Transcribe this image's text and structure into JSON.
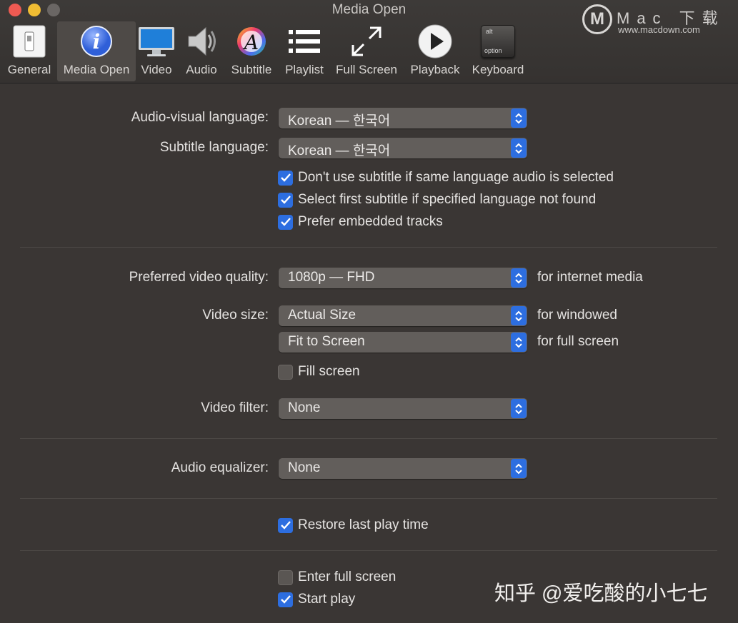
{
  "window": {
    "title": "Media Open"
  },
  "colors": {
    "accent": "#2d6ee0",
    "background": "#3a3634",
    "close": "#ee5a52",
    "minimize": "#f1bd33",
    "zoom": "#6a6664"
  },
  "toolbar": {
    "tabs": [
      {
        "label": "General",
        "icon": "switch-icon"
      },
      {
        "label": "Media Open",
        "icon": "info-icon"
      },
      {
        "label": "Video",
        "icon": "monitor-icon"
      },
      {
        "label": "Audio",
        "icon": "speaker-icon"
      },
      {
        "label": "Subtitle",
        "icon": "font-icon"
      },
      {
        "label": "Playlist",
        "icon": "list-icon"
      },
      {
        "label": "Full Screen",
        "icon": "expand-icon"
      },
      {
        "label": "Playback",
        "icon": "play-icon"
      },
      {
        "label": "Keyboard",
        "icon": "keyboard-icon"
      }
    ],
    "selected": "Media Open",
    "keycap": {
      "top": "alt",
      "bottom": "option"
    }
  },
  "watermark": {
    "logo": "M",
    "text": "Mac 下载",
    "url": "www.macdown.com"
  },
  "language": {
    "audio_label": "Audio-visual language:",
    "audio_value": "Korean — 한국어",
    "subtitle_label": "Subtitle language:",
    "subtitle_value": "Korean — 한국어",
    "options": [
      {
        "label": "Don't use subtitle if same language audio is selected",
        "checked": true
      },
      {
        "label": "Select first subtitle if specified language not found",
        "checked": true
      },
      {
        "label": "Prefer embedded tracks",
        "checked": true
      }
    ]
  },
  "video": {
    "quality_label": "Preferred video quality:",
    "quality_value": "1080p — FHD",
    "quality_suffix": "for internet media",
    "size_label": "Video size:",
    "windowed_value": "Actual Size",
    "windowed_suffix": "for windowed",
    "fullscreen_value": "Fit to Screen",
    "fullscreen_suffix": "for full screen",
    "fill_screen": {
      "label": "Fill screen",
      "checked": false
    },
    "filter_label": "Video filter:",
    "filter_value": "None"
  },
  "audio": {
    "equalizer_label": "Audio equalizer:",
    "equalizer_value": "None"
  },
  "resume": {
    "label": "Restore last play time",
    "checked": true
  },
  "startup": {
    "enter_full_screen": {
      "label": "Enter full screen",
      "checked": false
    },
    "start_play": {
      "label": "Start play",
      "checked": true
    }
  },
  "overlay": {
    "credit": "知乎 @爱吃酸的小七七"
  }
}
